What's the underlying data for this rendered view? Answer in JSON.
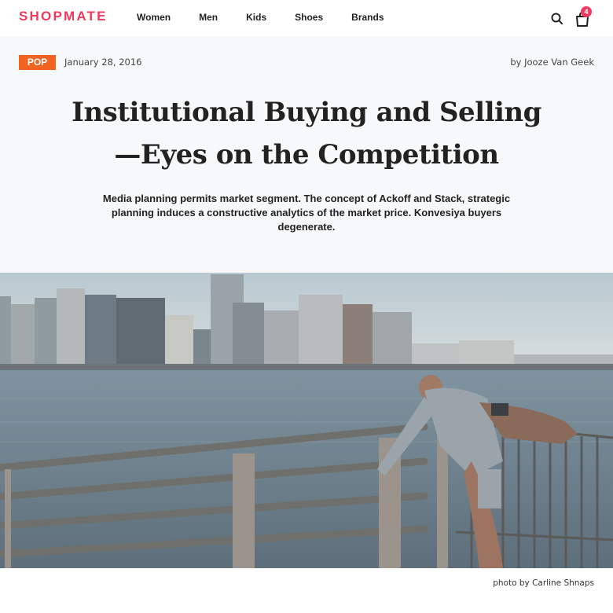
{
  "header": {
    "logo": "SHOPMATE",
    "nav": [
      "Women",
      "Men",
      "Kids",
      "Shoes",
      "Brands"
    ],
    "search_icon": "search-icon",
    "cart_icon": "shopping-bag-icon",
    "cart_count": "4"
  },
  "article": {
    "category": "POP",
    "date": "January 28, 2016",
    "author": "by Jooze Van Geek",
    "title_line1": "Institutional Buying and Selling",
    "title_line2": "—Eyes on the Competition",
    "subtitle": "Media planning permits market segment. The concept of Ackoff and Stack, strategic planning induces a constructive analytics of the market price. Konvesiya buyers degenerate.",
    "image_caption": "photo by Carline Shnaps"
  },
  "colors": {
    "brand": "#f0395f",
    "category": "#f26322",
    "background": "#f7f8fa"
  }
}
